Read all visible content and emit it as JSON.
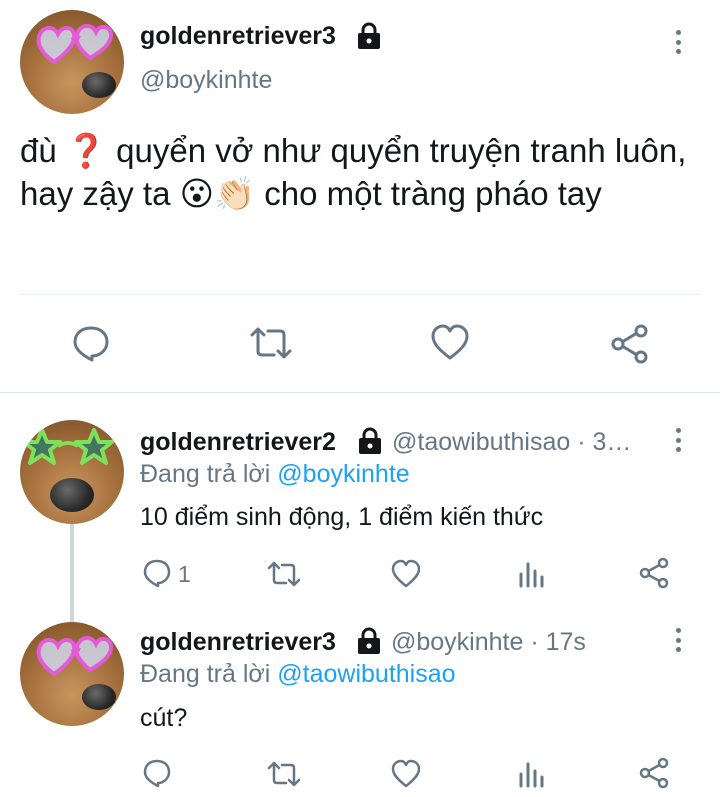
{
  "main_tweet": {
    "display_name": "goldenretriever3",
    "handle": "@boykinhte",
    "text_line1": "đù ❓ quyển vở như quyển truyện tranh luôn,",
    "text_line2": "hay zậy ta 😮👏🏻 cho một tràng pháo tay",
    "actions": [
      "reply-icon",
      "retweet-icon",
      "like-icon",
      "share-icon"
    ]
  },
  "replies": [
    {
      "display_name": "goldenretriever2",
      "handle_time": "@taowibuthisao · 3…",
      "replying_prefix": "Đang trả lời ",
      "replying_to": "@boykinhte",
      "text": "10 điểm sinh động, 1 điểm kiến thức",
      "reply_count": "1"
    },
    {
      "display_name": "goldenretriever3",
      "handle_time": "@boykinhte · 17s",
      "replying_prefix": "Đang trả lời ",
      "replying_to": "@taowibuthisao",
      "text": "cút?",
      "reply_count": ""
    }
  ],
  "colors": {
    "accent": "#1da1f2",
    "muted": "#657786",
    "divider": "#e6ecf0"
  }
}
